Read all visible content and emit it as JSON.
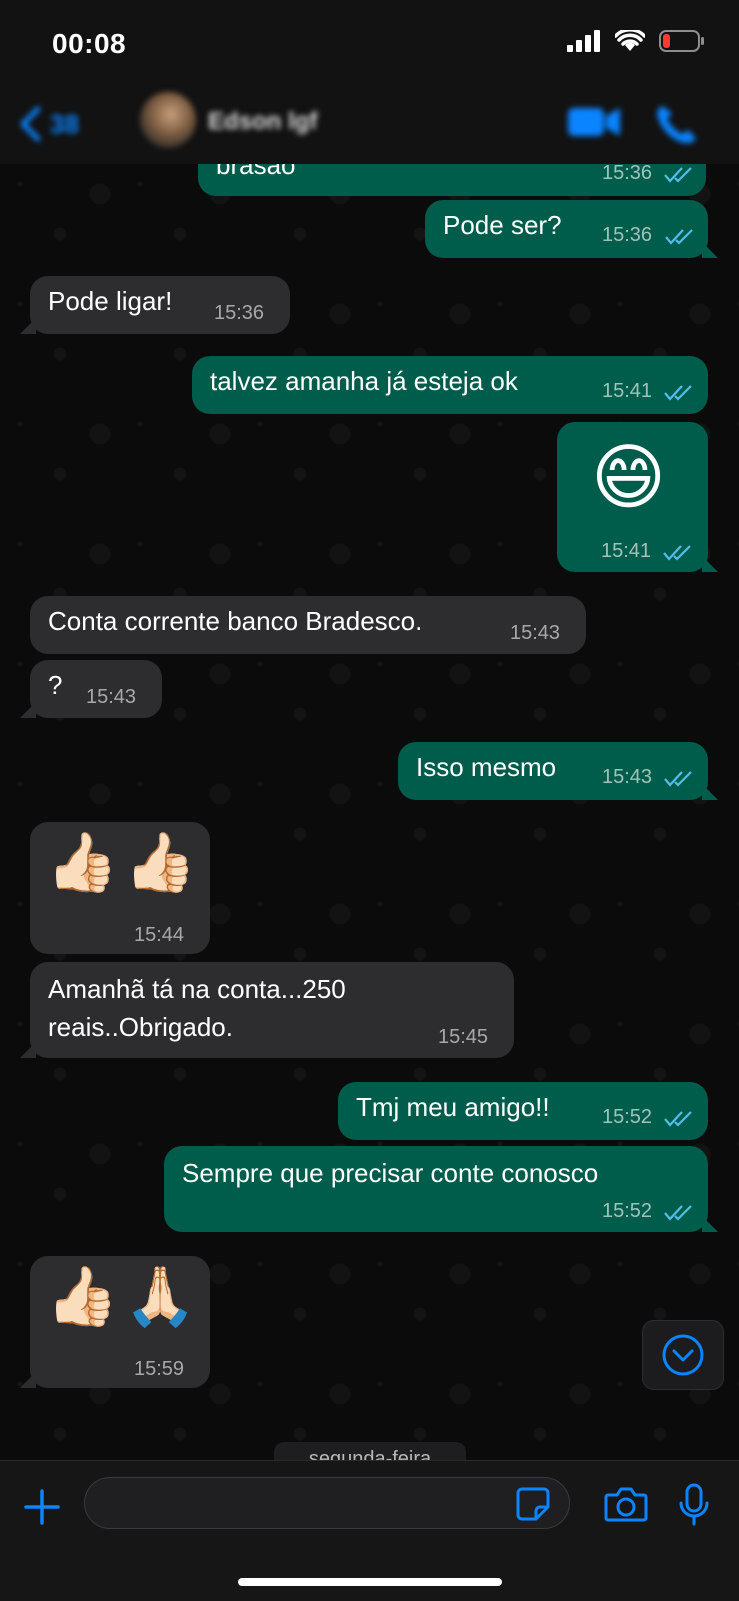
{
  "status_bar": {
    "time": "00:08"
  },
  "header": {
    "back_count": "38",
    "contact_name": "Edson lgf"
  },
  "messages": [
    {
      "dir": "out",
      "text": "brasão",
      "time": "15:36"
    },
    {
      "dir": "out",
      "text": "Pode ser?",
      "time": "15:36"
    },
    {
      "dir": "in",
      "text": "Pode ligar!",
      "time": "15:36"
    },
    {
      "dir": "out",
      "text": "talvez amanha já esteja ok",
      "time": "15:41"
    },
    {
      "dir": "out",
      "text": "😄",
      "time": "15:41"
    },
    {
      "dir": "in",
      "text": "Conta corrente banco Bradesco.",
      "time": "15:43"
    },
    {
      "dir": "in",
      "text": "?",
      "time": "15:43"
    },
    {
      "dir": "out",
      "text": "Isso mesmo",
      "time": "15:43"
    },
    {
      "dir": "in",
      "text": "👍🏻👍🏻",
      "time": "15:44"
    },
    {
      "dir": "in",
      "line1": "Amanhã tá na conta...250",
      "line2": "reais..Obrigado.",
      "time": "15:45"
    },
    {
      "dir": "out",
      "text": "Tmj meu amigo!!",
      "time": "15:52"
    },
    {
      "dir": "out",
      "text": "Sempre que precisar conte conosco",
      "time": "15:52"
    },
    {
      "dir": "in",
      "text": "👍🏻🙏🏻",
      "time": "15:59"
    }
  ],
  "date_separator": "segunda-feira",
  "composer": {
    "value": ""
  },
  "colors": {
    "outgoing": "#005c4b",
    "incoming": "#2d2d2f",
    "accent": "#0a84ff",
    "read_ticks": "#53bdeb"
  },
  "icons": [
    "back-chevron-icon",
    "video-call-icon",
    "phone-icon",
    "scroll-down-icon",
    "plus-icon",
    "sticker-icon",
    "camera-icon",
    "microphone-icon"
  ]
}
